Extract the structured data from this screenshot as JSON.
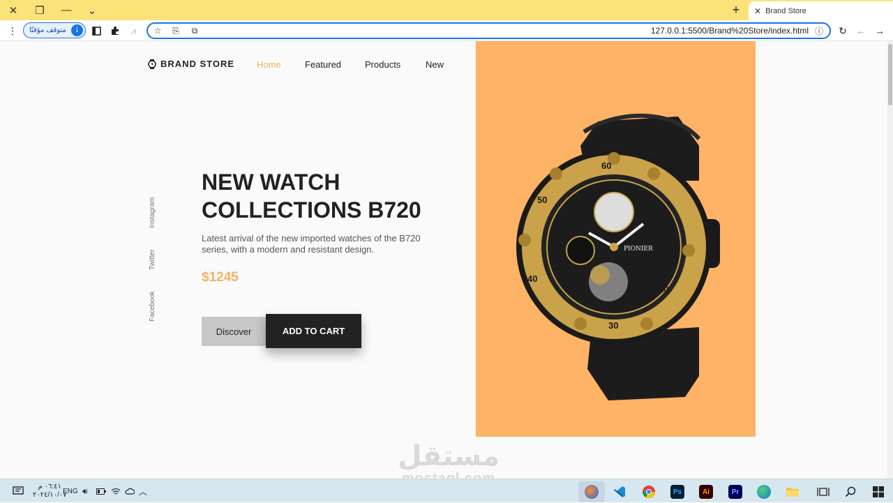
{
  "browser": {
    "tab_title": "Brand Store",
    "url": "127.0.0.1:5500/Brand%20Store/index.html",
    "profile_label": "متوقف مؤقتًا",
    "profile_initial": "i"
  },
  "site": {
    "brand": "BRAND STORE",
    "nav": [
      {
        "label": "Home",
        "active": true
      },
      {
        "label": "Featured",
        "active": false
      },
      {
        "label": "Products",
        "active": false
      },
      {
        "label": "New",
        "active": false
      }
    ],
    "socials": [
      "Instagram",
      "Twitter",
      "Facebook"
    ],
    "hero": {
      "title_line1": "NEW WATCH",
      "title_line2": "COLLECTIONS B720",
      "description": "Latest arrival of the new imported watches of the B720 series, with a modern and resistant design.",
      "price": "$1245",
      "discover_label": "Discover",
      "cart_label": "ADD TO CART",
      "image_bg": "#feb366",
      "watch_bezel_text": [
        "60",
        "50",
        "40",
        "30",
        "20"
      ],
      "watch_dial_text": "PIONIER"
    },
    "accent_color": "#f4b262"
  },
  "watermark": {
    "arabic": "مستقل",
    "latin": "mostaql.com"
  },
  "taskbar": {
    "time": "٠٦:٤١ م",
    "date": "٢٠٢٤/١٠/٠٧",
    "language": "ENG",
    "apps": [
      "edge-dev",
      "vscode",
      "chrome",
      "photoshop",
      "illustrator",
      "premiere",
      "edge",
      "file-explorer"
    ],
    "app_labels": {
      "photoshop": "Ps",
      "illustrator": "Ai",
      "premiere": "Pr"
    }
  }
}
